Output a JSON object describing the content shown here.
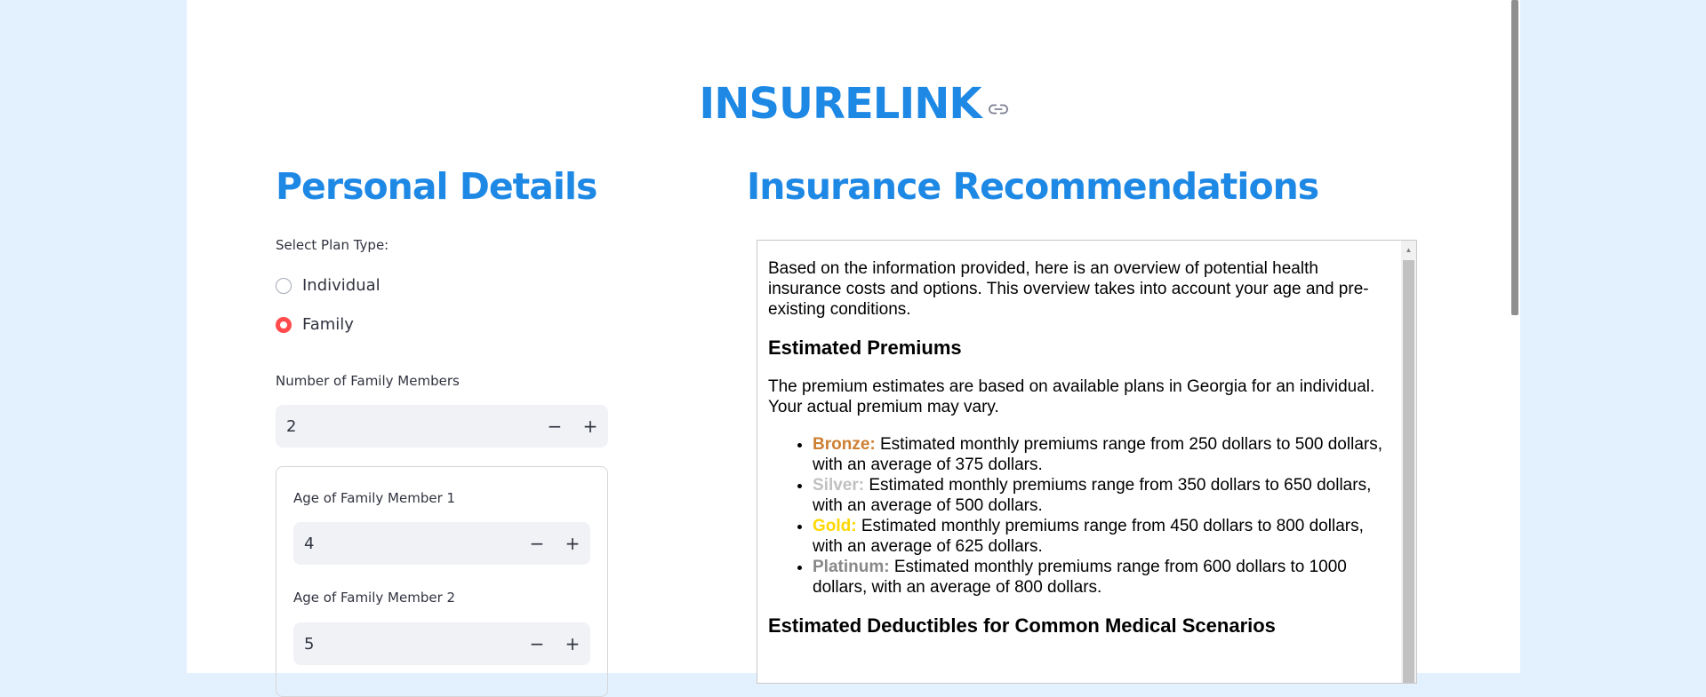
{
  "app": {
    "title": "INSURELINK"
  },
  "personal": {
    "heading": "Personal Details",
    "plan_type_label": "Select Plan Type:",
    "plan_options": [
      {
        "label": "Individual",
        "selected": false
      },
      {
        "label": "Family",
        "selected": true
      }
    ],
    "members_label": "Number of Family Members",
    "members_value": "2",
    "member_ages": [
      {
        "label": "Age of Family Member 1",
        "value": "4"
      },
      {
        "label": "Age of Family Member 2",
        "value": "5"
      }
    ],
    "stepper_minus": "−",
    "stepper_plus": "+"
  },
  "recommendations": {
    "heading": "Insurance Recommendations",
    "intro": "Based on the information provided, here is an overview of potential health insurance costs and options. This overview takes into account your age and pre-existing conditions.",
    "premiums_heading": "Estimated Premiums",
    "premiums_text": "The premium estimates are based on available plans in Georgia for an individual. Your actual premium may vary.",
    "tiers": [
      {
        "name": "Bronze:",
        "color": "#cd7f32",
        "text": " Estimated monthly premiums range from 250 dollars to 500 dollars, with an average of 375 dollars."
      },
      {
        "name": "Silver:",
        "color": "#c0c0c0",
        "text": " Estimated monthly premiums range from 350 dollars to 650 dollars, with an average of 500 dollars."
      },
      {
        "name": "Gold:",
        "color": "#ffd700",
        "text": " Estimated monthly premiums range from 450 dollars to 800 dollars, with an average of 625 dollars."
      },
      {
        "name": "Platinum:",
        "color": "#888888",
        "text": " Estimated monthly premiums range from 600 dollars to 1000 dollars, with an average of 800 dollars."
      }
    ],
    "deductibles_heading": "Estimated Deductibles for Common Medical Scenarios"
  },
  "colors": {
    "accent": "#1e88e5",
    "radio_selected": "#ff4b4b",
    "input_bg": "#f0f2f6",
    "page_bg": "#e3f0fd"
  }
}
